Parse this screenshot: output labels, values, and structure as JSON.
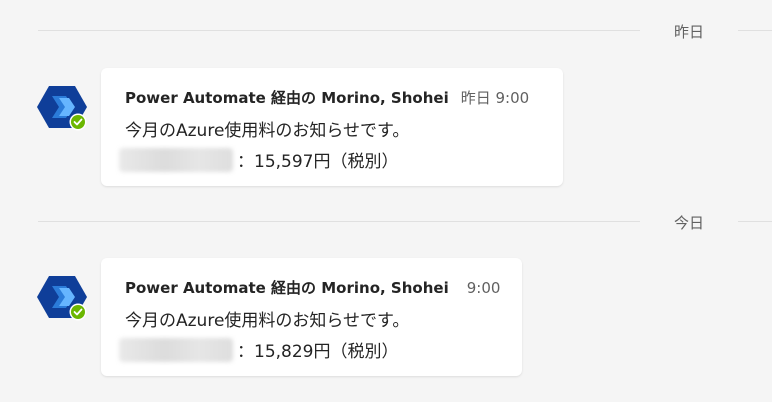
{
  "dividers": [
    {
      "label": "昨日"
    },
    {
      "label": "今日"
    }
  ],
  "messages": [
    {
      "sender": "Power Automate 経由の Morino, Shohei",
      "time": "昨日 9:00",
      "line1": "今月のAzure使用料のお知らせです。",
      "amount_text": "：15,597円（税別）",
      "avatar_icon": "power-automate-icon",
      "status_icon": "available-check-icon"
    },
    {
      "sender": "Power Automate 経由の Morino, Shohei",
      "time": "9:00",
      "line1": "今月のAzure使用料のお知らせです。",
      "amount_text": "：15,829円（税別）",
      "avatar_icon": "power-automate-icon",
      "status_icon": "available-check-icon"
    }
  ],
  "colors": {
    "background": "#f5f5f5",
    "bubble": "#ffffff",
    "avatar_blue": "#0f3e99",
    "presence_green": "#6bb700"
  }
}
